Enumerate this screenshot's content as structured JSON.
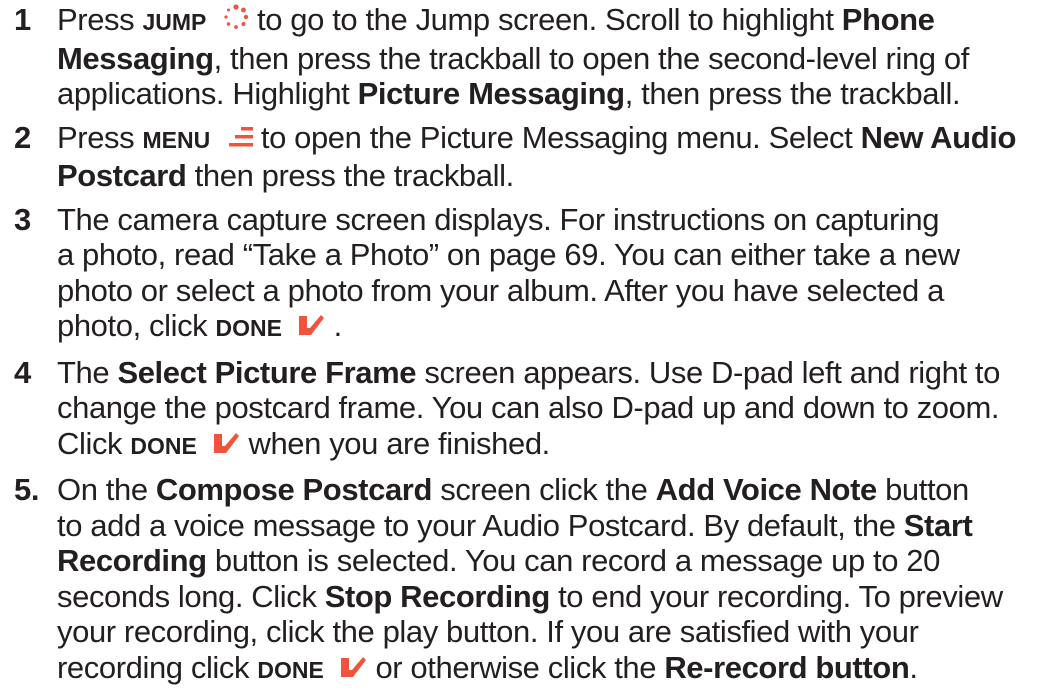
{
  "colors": {
    "accent": "#f0543c",
    "text": "#231f20"
  },
  "icons": {
    "jump": "jump-dots-icon",
    "menu": "menu-lines-icon",
    "done": "done-check-icon"
  },
  "steps": [
    {
      "number": "1",
      "lines": [
        {
          "t1": "Press ",
          "k1": "JUMP",
          "t2": " to go to the Jump screen. Scroll to highlight ",
          "b1": "Phone"
        },
        {
          "b1": "Messaging",
          "t1": ", then press the trackball to open the second-level ring of"
        },
        {
          "t1": "applications. Highlight ",
          "b1": "Picture Messaging",
          "t2": ", then press the trackball."
        }
      ]
    },
    {
      "number": "2",
      "lines": [
        {
          "t1": "Press ",
          "k1": "MENU",
          "t2": " to open the Picture Messaging menu. Select ",
          "b1": "New Audio"
        },
        {
          "b1": "Postcard",
          "t1": " then press the trackball."
        }
      ]
    },
    {
      "number": "3",
      "lines": [
        {
          "t1": "The camera capture screen displays. For instructions on capturing"
        },
        {
          "t1": "a photo, read “Take a Photo” on page 69. You can either take a new"
        },
        {
          "t1": "photo or select a photo from your album. After you have selected a"
        },
        {
          "t1": "photo, click ",
          "k1": "DONE",
          "t2": "."
        }
      ]
    },
    {
      "number": "4",
      "lines": [
        {
          "t1": "The ",
          "b1": "Select Picture Frame",
          "t2": " screen appears. Use D-pad left and right to"
        },
        {
          "t1": "change the postcard frame. You can also D-pad up and down to zoom."
        },
        {
          "t1": "Click ",
          "k1": "DONE",
          "t2": " when you are finished."
        }
      ]
    },
    {
      "number": "5.",
      "lines": [
        {
          "t1": "On the ",
          "b1": "Compose Postcard",
          "t2": " screen click the ",
          "b2": "Add Voice Note",
          "t3": " button"
        },
        {
          "t1": "to add a voice message to your Audio Postcard. By default, the ",
          "b1": "Start"
        },
        {
          "b1": "Recording",
          "t1": " button is selected. You can record a message up to 20"
        },
        {
          "t1": "seconds long. Click ",
          "b1": "Stop Recording",
          "t2": " to end your recording. To preview"
        },
        {
          "t1": "your recording, click the play button. If you are satisfied with your"
        },
        {
          "t1": "recording click ",
          "k1": "DONE",
          "t2": " or otherwise click the ",
          "b1": "Re-record button",
          "t3": "."
        }
      ]
    }
  ]
}
